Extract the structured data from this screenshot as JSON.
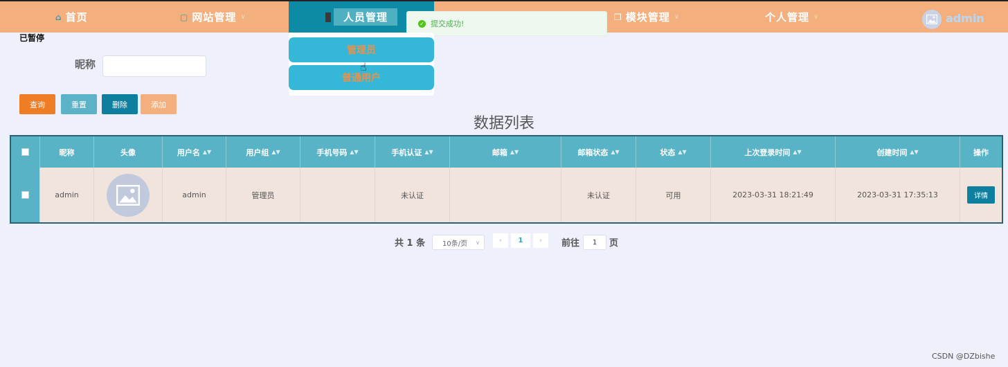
{
  "nav": {
    "home": "首页",
    "website": "网站管理",
    "people": "人员管理",
    "modules": "模块管理",
    "personal": "个人管理",
    "user": "admin"
  },
  "toast": {
    "message": "提交成功!"
  },
  "dropdown": {
    "items": [
      "管理员",
      "普通用户"
    ]
  },
  "status_text": "已暂停",
  "search": {
    "label": "昵称",
    "value": "",
    "placeholder": ""
  },
  "buttons": {
    "query": "查询",
    "reset": "重置",
    "delete": "删除",
    "add": "添加"
  },
  "list_title": "数据列表",
  "table": {
    "headers": [
      "昵称",
      "头像",
      "用户名",
      "用户组",
      "手机号码",
      "手机认证",
      "邮箱",
      "邮箱状态",
      "状态",
      "上次登录时间",
      "创建时间",
      "操作"
    ],
    "rows": [
      {
        "nickname": "admin",
        "username": "admin",
        "group": "管理员",
        "phone": "",
        "phone_verified": "未认证",
        "email": "",
        "email_status": "未认证",
        "status": "可用",
        "last_login": "2023-03-31 18:21:49",
        "created": "2023-03-31 17:35:13",
        "action": "详情"
      }
    ]
  },
  "pagination": {
    "total": "共 1 条",
    "page_size": "10条/页",
    "current": "1",
    "goto_label": "前往",
    "goto_value": "1",
    "page_suffix": "页"
  },
  "watermark": "CSDN @DZbishe",
  "colors": {
    "nav": "#f3b07e",
    "active": "#0d8aa6",
    "table_head": "#59b3c6",
    "accent": "#ef7d25"
  }
}
